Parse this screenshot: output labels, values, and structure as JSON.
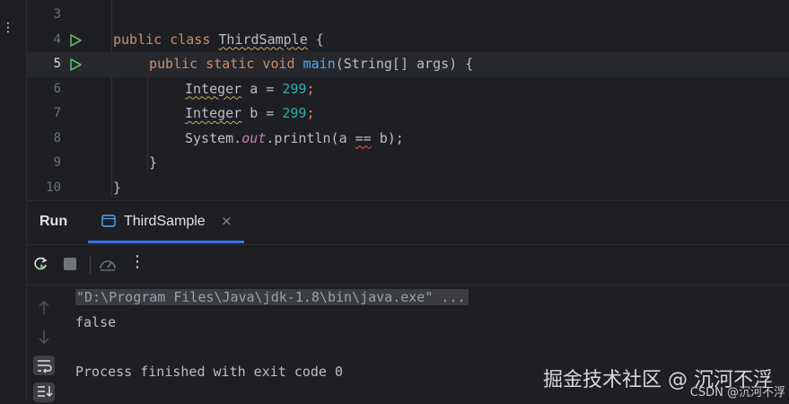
{
  "editor": {
    "lines": [
      {
        "num": "3"
      },
      {
        "num": "4"
      },
      {
        "num": "5"
      },
      {
        "num": "6"
      },
      {
        "num": "7"
      },
      {
        "num": "8"
      },
      {
        "num": "9"
      },
      {
        "num": "10"
      }
    ],
    "code": {
      "l4_kw": "public class",
      "l4_name": "ThirdSample",
      "l4_brace": " {",
      "l5_kw": "public static void",
      "l5_fn": "main",
      "l5_rest": "(String[] args) {",
      "l6_type": "Integer",
      "l6_mid": " a = ",
      "l6_num": "299",
      "l6_end": ";",
      "l7_type": "Integer",
      "l7_mid": " b = ",
      "l7_num": "299",
      "l7_end": ";",
      "l8_pre": "System.",
      "l8_field": "out",
      "l8_mid": ".println(a ",
      "l8_op": "==",
      "l8_end": " b);",
      "l9": "}",
      "l10": "}"
    }
  },
  "run_window": {
    "title": "Run",
    "tab_label": "ThirdSample",
    "tab_close": "×",
    "more_label": "⋮"
  },
  "console": {
    "command": "\"D:\\Program Files\\Java\\jdk-1.8\\bin\\java.exe\" ...",
    "output": "false",
    "exit_message": "Process finished with exit code 0"
  },
  "watermark": {
    "main": "掘金技术社区 @ 沉河不浮",
    "sub": "CSDN @沉河不浮"
  },
  "colors": {
    "keyword": "#cf8e6d",
    "function": "#56a8f5",
    "number": "#2aacb8",
    "static_field": "#c77dbb",
    "accent": "#3574f0",
    "run_green": "#5fb865"
  }
}
